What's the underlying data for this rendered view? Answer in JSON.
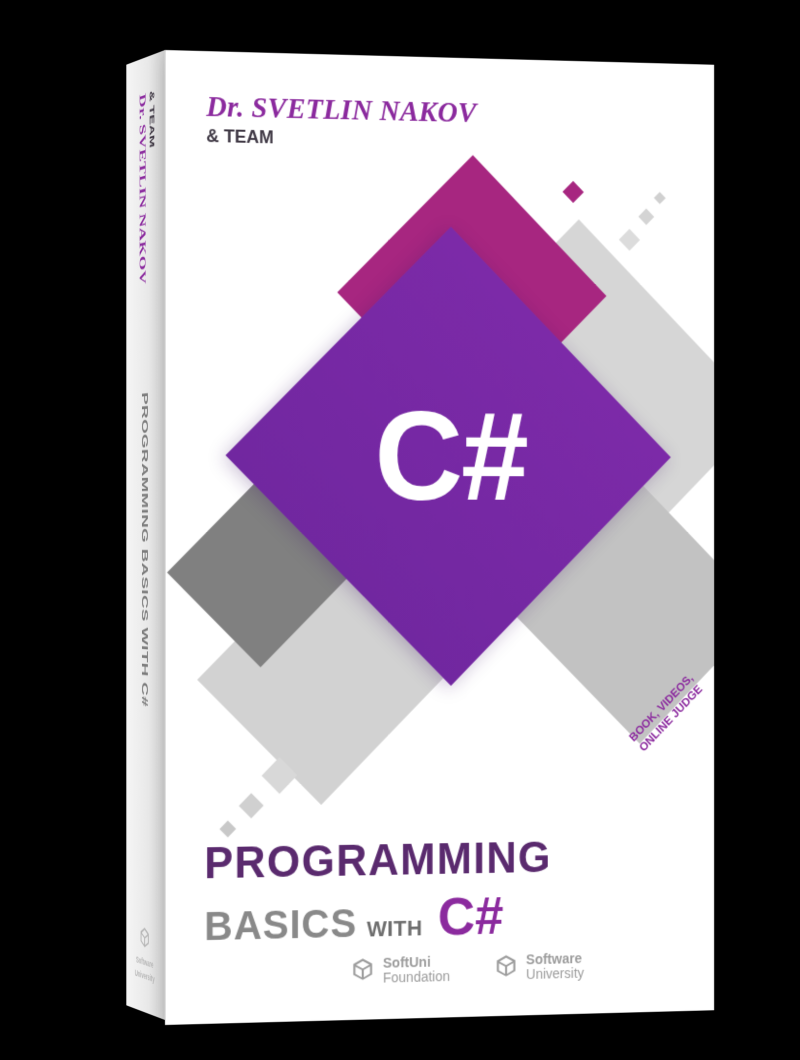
{
  "author": {
    "name": "Dr. SVETLIN NAKOV",
    "team": "& TEAM"
  },
  "spine": {
    "author": "Dr. SVETLIN NAKOV",
    "team": "& TEAM",
    "title": "PROGRAMMING BASICS WITH C#",
    "logo": {
      "line1": "Software",
      "line2": "University"
    }
  },
  "centerpiece": {
    "language": "C#"
  },
  "tagline": {
    "line1": "BOOK, VIDEOS,",
    "line2": "ONLINE JUDGE"
  },
  "title": {
    "row1": "PROGRAMMING",
    "basics": "BASICS",
    "with": "WITH",
    "language": "C#"
  },
  "footer_logos": [
    {
      "line1": "SoftUni",
      "line2": "Foundation"
    },
    {
      "line1": "Software",
      "line2": "University"
    }
  ]
}
